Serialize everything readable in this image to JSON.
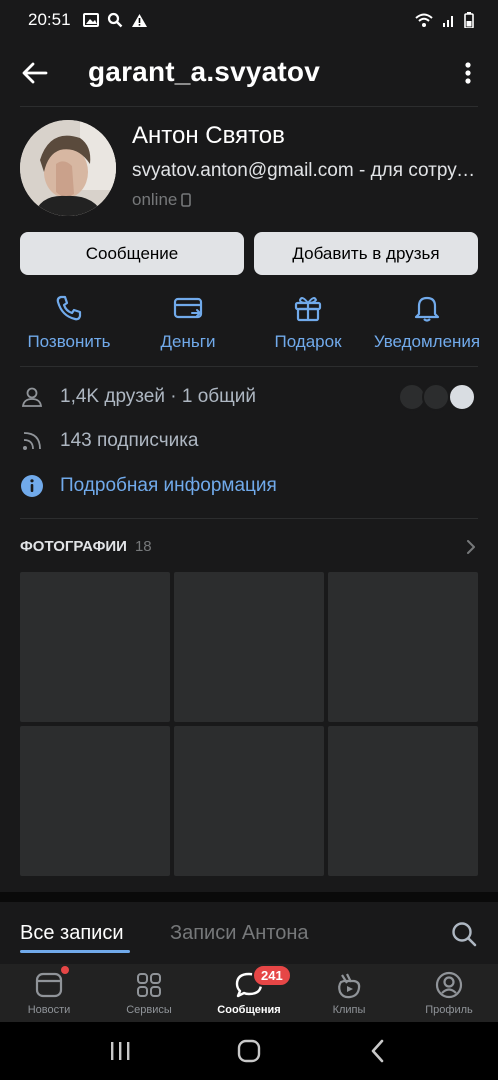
{
  "status_bar": {
    "time": "20:51"
  },
  "header": {
    "title": "garant_a.svyatov"
  },
  "profile": {
    "name": "Антон Святов",
    "status": "svyatov.anton@gmail.com - для сотрудничества",
    "online": "online"
  },
  "buttons": {
    "message": "Сообщение",
    "add_friend": "Добавить в друзья"
  },
  "actions": [
    {
      "label": "Позвонить",
      "icon": "phone-icon"
    },
    {
      "label": "Деньги",
      "icon": "card-icon"
    },
    {
      "label": "Подарок",
      "icon": "gift-icon"
    },
    {
      "label": "Уведомления",
      "icon": "bell-icon"
    }
  ],
  "info": {
    "friends": "1,4K друзей · 1 общий",
    "followers": "143 подписчика",
    "details": "Подробная информация"
  },
  "photos": {
    "title": "ФОТОГРАФИИ",
    "count": "18"
  },
  "wall_tabs": {
    "all": "Все записи",
    "own": "Записи Антона"
  },
  "bottom_nav": [
    {
      "label": "Новости",
      "icon": "news-icon"
    },
    {
      "label": "Сервисы",
      "icon": "services-icon"
    },
    {
      "label": "Сообщения",
      "icon": "messages-icon",
      "badge": "241"
    },
    {
      "label": "Клипы",
      "icon": "clips-icon"
    },
    {
      "label": "Профиль",
      "icon": "profile-icon"
    }
  ],
  "colors": {
    "background": "#19191a",
    "accent": "#71aaeb",
    "badge": "#e64646",
    "button_bg": "#e1e3e6"
  }
}
